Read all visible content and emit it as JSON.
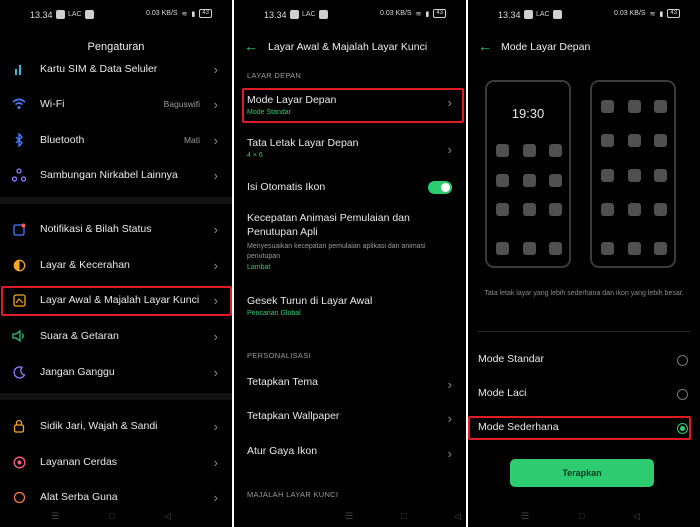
{
  "status": {
    "time": "13.34",
    "net": "0.03 KB/S",
    "battery": "43"
  },
  "panel1": {
    "title": "Pengaturan",
    "items": [
      {
        "label": "Kartu SIM & Data Seluler",
        "value": "",
        "icon": "sim-signal-icon"
      },
      {
        "label": "Wi-Fi",
        "value": "Baguswifi",
        "icon": "wifi-icon"
      },
      {
        "label": "Bluetooth",
        "value": "Mati",
        "icon": "bluetooth-icon"
      },
      {
        "label": "Sambungan Nirkabel Lainnya",
        "value": "",
        "icon": "share-nodes-icon"
      },
      {
        "label": "Notifikasi & Bilah Status",
        "value": "",
        "icon": "notification-icon"
      },
      {
        "label": "Layar &  Kecerahan",
        "value": "",
        "icon": "brightness-icon"
      },
      {
        "label": "Layar Awal & Majalah Layar Kunci",
        "value": "",
        "icon": "home-screen-icon"
      },
      {
        "label": "Suara & Getaran",
        "value": "",
        "icon": "sound-icon"
      },
      {
        "label": "Jangan Ganggu",
        "value": "",
        "icon": "moon-icon"
      },
      {
        "label": "Sidik Jari, Wajah & Sandi",
        "value": "",
        "icon": "lock-icon"
      },
      {
        "label": "Layanan Cerdas",
        "value": "",
        "icon": "smart-service-icon"
      },
      {
        "label": "Alat Serba Guna",
        "value": "",
        "icon": "tools-icon"
      }
    ]
  },
  "panel2": {
    "title": "Layar Awal & Majalah Layar Kunci",
    "section1": "LAYAR DEPAN",
    "mode_title": "Mode Layar Depan",
    "mode_sub": "Mode Standar",
    "layout_title": "Tata Letak Layar Depan",
    "layout_sub": "4 × 6",
    "auto_title": "Isi Otomatis Ikon",
    "anim_title": "Kecepatan Animasi Pemulaian dan Penutupan Apli",
    "anim_desc": "Menyesuaikan kecepatan pemulaian aplikasi dan animasi penutupan",
    "anim_sub": "Lambat",
    "swipe_title": "Gesek Turun di Layar Awal",
    "swipe_sub": "Pencarian Global",
    "section2": "PERSONALISASI",
    "theme": "Tetapkan Tema",
    "wallpaper": "Tetapkan Wallpaper",
    "iconstyle": "Atur Gaya Ikon",
    "section3": "MAJALAH LAYAR KUNCI"
  },
  "panel3": {
    "title": "Mode Layar Depan",
    "clock": "19:30",
    "caption": "Tata letak layar yang lebih sederhana dan ikon yang lebih besar.",
    "options": [
      "Mode Standar",
      "Mode Laci",
      "Mode Sederhana"
    ],
    "selected": "Mode Sederhana",
    "apply": "Terapkan"
  },
  "colors": {
    "accent": "#2ecc71",
    "highlight": "#e01b24",
    "background": "#000000"
  }
}
